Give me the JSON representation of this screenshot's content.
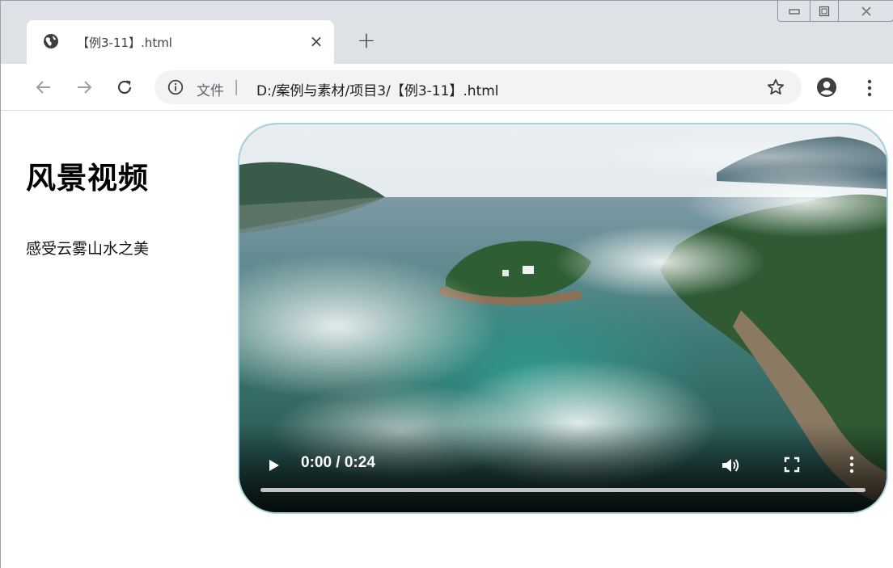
{
  "browser": {
    "tab": {
      "title": "【例3-11】.html",
      "favicon": "globe-icon"
    },
    "new_tab_label": "+",
    "close_tab_label": "×",
    "window_controls": [
      "minimize-icon",
      "maximize-icon",
      "close-icon"
    ],
    "omnibox": {
      "scheme_label": "文件",
      "separator": "|",
      "url": "D:/案例与素材/项目3/【例3-11】.html"
    }
  },
  "page": {
    "heading": "风景视频",
    "description": "感受云雾山水之美"
  },
  "video": {
    "time_display": "0:00 / 0:24",
    "current_time": "0:00",
    "duration": "0:24",
    "progress_fraction": 0,
    "border_color": "#a9d3df"
  }
}
